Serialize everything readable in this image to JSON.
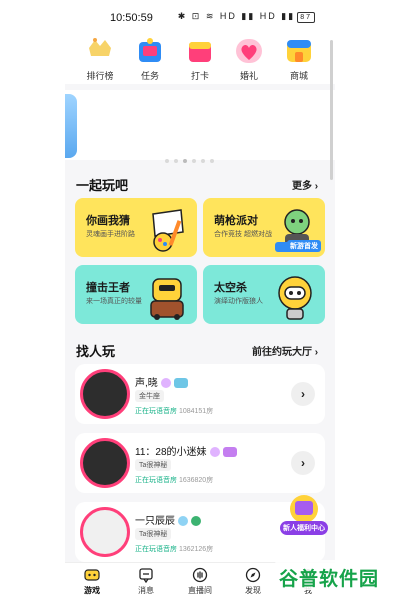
{
  "status": {
    "time": "10:50:59",
    "icons": "✱ ⊡ ≋ HD ▮▮ HD ▮▮",
    "battery": "87"
  },
  "topnav": {
    "items": [
      {
        "label": "排行榜",
        "icon": "crown-icon",
        "color": "#f5c842"
      },
      {
        "label": "任务",
        "icon": "gift-box-icon",
        "color": "#2f8cf5"
      },
      {
        "label": "打卡",
        "icon": "calendar-icon",
        "color": "#ff3f7a"
      },
      {
        "label": "婚礼",
        "icon": "heart-icon",
        "color": "#ff5c8a"
      },
      {
        "label": "商城",
        "icon": "shop-icon",
        "color": "#ffd23a"
      }
    ]
  },
  "play_section": {
    "title": "一起玩吧",
    "more": "更多"
  },
  "games": [
    {
      "title": "你画我猜",
      "subtitle": "灵魂画手进阶路",
      "bg": "#ffe45c"
    },
    {
      "title": "萌枪派对",
      "subtitle": "合作竞技 超燃对战",
      "bg": "#ffe45c",
      "tag": "新游首发"
    },
    {
      "title": "撞击王者",
      "subtitle": "来一场真正的较量",
      "bg": "#7de8d9"
    },
    {
      "title": "太空杀",
      "subtitle": "演绎动作版狼人",
      "bg": "#7de8d9"
    }
  ],
  "find_section": {
    "title": "找人玩",
    "more": "前往约玩大厅"
  },
  "players": [
    {
      "name": "声,晓",
      "tag": "金牛座",
      "status": "正在玩语音房",
      "room": "1084151房"
    },
    {
      "name": "11：28的小迷妹",
      "tag": "Ta很神秘",
      "status": "正在玩语音房",
      "room": "1636820房"
    },
    {
      "name": "一只辰辰",
      "tag": "Ta很神秘",
      "status": "正在玩语音房",
      "room": "1362126房"
    }
  ],
  "float_badge": {
    "label": "新人福利中心"
  },
  "bottom_tabs": [
    {
      "label": "游戏",
      "icon": "game-controller-icon",
      "active": true
    },
    {
      "label": "消息",
      "icon": "message-icon"
    },
    {
      "label": "直播间",
      "icon": "live-icon"
    },
    {
      "label": "发现",
      "icon": "compass-icon"
    },
    {
      "label": "我",
      "icon": "profile-icon"
    }
  ],
  "watermark": {
    "text": "谷普软件园"
  },
  "colors": {
    "accent_pink": "#ff3f7a",
    "live_green": "#1bb38a",
    "yellow_card": "#ffe45c",
    "teal_card": "#7de8d9"
  }
}
